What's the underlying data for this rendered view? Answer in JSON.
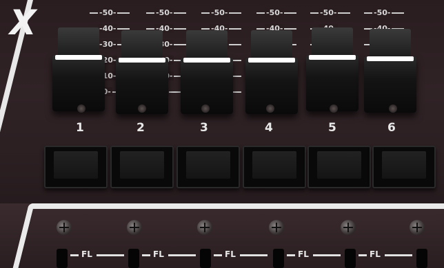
{
  "brand_letter": "X",
  "scale_labels": [
    "50",
    "40",
    "30",
    "20",
    "10",
    "0"
  ],
  "channels": [
    "1",
    "2",
    "3",
    "4",
    "5",
    "6"
  ],
  "bottom_label": "FL"
}
